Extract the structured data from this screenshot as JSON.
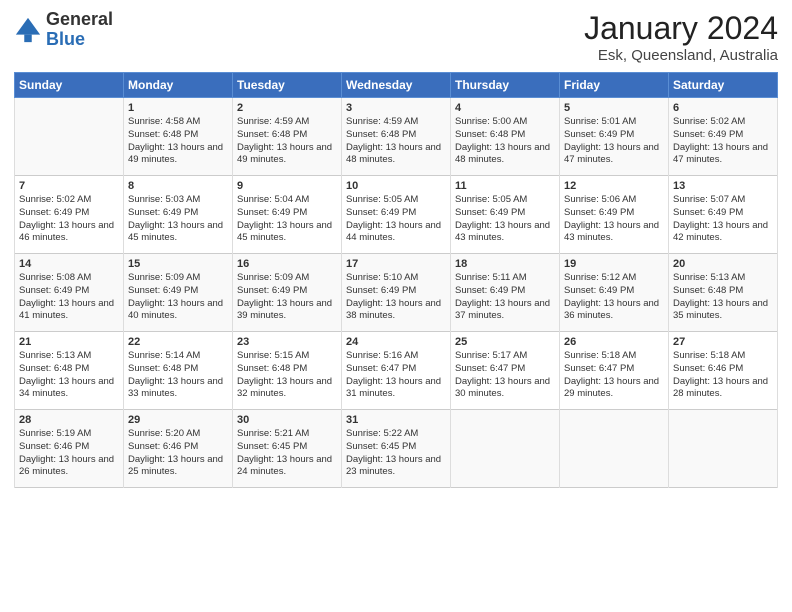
{
  "header": {
    "logo_general": "General",
    "logo_blue": "Blue",
    "month_title": "January 2024",
    "location": "Esk, Queensland, Australia"
  },
  "columns": [
    "Sunday",
    "Monday",
    "Tuesday",
    "Wednesday",
    "Thursday",
    "Friday",
    "Saturday"
  ],
  "weeks": [
    [
      {
        "num": "",
        "sunrise": "",
        "sunset": "",
        "daylight": ""
      },
      {
        "num": "1",
        "sunrise": "Sunrise: 4:58 AM",
        "sunset": "Sunset: 6:48 PM",
        "daylight": "Daylight: 13 hours and 49 minutes."
      },
      {
        "num": "2",
        "sunrise": "Sunrise: 4:59 AM",
        "sunset": "Sunset: 6:48 PM",
        "daylight": "Daylight: 13 hours and 49 minutes."
      },
      {
        "num": "3",
        "sunrise": "Sunrise: 4:59 AM",
        "sunset": "Sunset: 6:48 PM",
        "daylight": "Daylight: 13 hours and 48 minutes."
      },
      {
        "num": "4",
        "sunrise": "Sunrise: 5:00 AM",
        "sunset": "Sunset: 6:48 PM",
        "daylight": "Daylight: 13 hours and 48 minutes."
      },
      {
        "num": "5",
        "sunrise": "Sunrise: 5:01 AM",
        "sunset": "Sunset: 6:49 PM",
        "daylight": "Daylight: 13 hours and 47 minutes."
      },
      {
        "num": "6",
        "sunrise": "Sunrise: 5:02 AM",
        "sunset": "Sunset: 6:49 PM",
        "daylight": "Daylight: 13 hours and 47 minutes."
      }
    ],
    [
      {
        "num": "7",
        "sunrise": "Sunrise: 5:02 AM",
        "sunset": "Sunset: 6:49 PM",
        "daylight": "Daylight: 13 hours and 46 minutes."
      },
      {
        "num": "8",
        "sunrise": "Sunrise: 5:03 AM",
        "sunset": "Sunset: 6:49 PM",
        "daylight": "Daylight: 13 hours and 45 minutes."
      },
      {
        "num": "9",
        "sunrise": "Sunrise: 5:04 AM",
        "sunset": "Sunset: 6:49 PM",
        "daylight": "Daylight: 13 hours and 45 minutes."
      },
      {
        "num": "10",
        "sunrise": "Sunrise: 5:05 AM",
        "sunset": "Sunset: 6:49 PM",
        "daylight": "Daylight: 13 hours and 44 minutes."
      },
      {
        "num": "11",
        "sunrise": "Sunrise: 5:05 AM",
        "sunset": "Sunset: 6:49 PM",
        "daylight": "Daylight: 13 hours and 43 minutes."
      },
      {
        "num": "12",
        "sunrise": "Sunrise: 5:06 AM",
        "sunset": "Sunset: 6:49 PM",
        "daylight": "Daylight: 13 hours and 43 minutes."
      },
      {
        "num": "13",
        "sunrise": "Sunrise: 5:07 AM",
        "sunset": "Sunset: 6:49 PM",
        "daylight": "Daylight: 13 hours and 42 minutes."
      }
    ],
    [
      {
        "num": "14",
        "sunrise": "Sunrise: 5:08 AM",
        "sunset": "Sunset: 6:49 PM",
        "daylight": "Daylight: 13 hours and 41 minutes."
      },
      {
        "num": "15",
        "sunrise": "Sunrise: 5:09 AM",
        "sunset": "Sunset: 6:49 PM",
        "daylight": "Daylight: 13 hours and 40 minutes."
      },
      {
        "num": "16",
        "sunrise": "Sunrise: 5:09 AM",
        "sunset": "Sunset: 6:49 PM",
        "daylight": "Daylight: 13 hours and 39 minutes."
      },
      {
        "num": "17",
        "sunrise": "Sunrise: 5:10 AM",
        "sunset": "Sunset: 6:49 PM",
        "daylight": "Daylight: 13 hours and 38 minutes."
      },
      {
        "num": "18",
        "sunrise": "Sunrise: 5:11 AM",
        "sunset": "Sunset: 6:49 PM",
        "daylight": "Daylight: 13 hours and 37 minutes."
      },
      {
        "num": "19",
        "sunrise": "Sunrise: 5:12 AM",
        "sunset": "Sunset: 6:49 PM",
        "daylight": "Daylight: 13 hours and 36 minutes."
      },
      {
        "num": "20",
        "sunrise": "Sunrise: 5:13 AM",
        "sunset": "Sunset: 6:48 PM",
        "daylight": "Daylight: 13 hours and 35 minutes."
      }
    ],
    [
      {
        "num": "21",
        "sunrise": "Sunrise: 5:13 AM",
        "sunset": "Sunset: 6:48 PM",
        "daylight": "Daylight: 13 hours and 34 minutes."
      },
      {
        "num": "22",
        "sunrise": "Sunrise: 5:14 AM",
        "sunset": "Sunset: 6:48 PM",
        "daylight": "Daylight: 13 hours and 33 minutes."
      },
      {
        "num": "23",
        "sunrise": "Sunrise: 5:15 AM",
        "sunset": "Sunset: 6:48 PM",
        "daylight": "Daylight: 13 hours and 32 minutes."
      },
      {
        "num": "24",
        "sunrise": "Sunrise: 5:16 AM",
        "sunset": "Sunset: 6:47 PM",
        "daylight": "Daylight: 13 hours and 31 minutes."
      },
      {
        "num": "25",
        "sunrise": "Sunrise: 5:17 AM",
        "sunset": "Sunset: 6:47 PM",
        "daylight": "Daylight: 13 hours and 30 minutes."
      },
      {
        "num": "26",
        "sunrise": "Sunrise: 5:18 AM",
        "sunset": "Sunset: 6:47 PM",
        "daylight": "Daylight: 13 hours and 29 minutes."
      },
      {
        "num": "27",
        "sunrise": "Sunrise: 5:18 AM",
        "sunset": "Sunset: 6:46 PM",
        "daylight": "Daylight: 13 hours and 28 minutes."
      }
    ],
    [
      {
        "num": "28",
        "sunrise": "Sunrise: 5:19 AM",
        "sunset": "Sunset: 6:46 PM",
        "daylight": "Daylight: 13 hours and 26 minutes."
      },
      {
        "num": "29",
        "sunrise": "Sunrise: 5:20 AM",
        "sunset": "Sunset: 6:46 PM",
        "daylight": "Daylight: 13 hours and 25 minutes."
      },
      {
        "num": "30",
        "sunrise": "Sunrise: 5:21 AM",
        "sunset": "Sunset: 6:45 PM",
        "daylight": "Daylight: 13 hours and 24 minutes."
      },
      {
        "num": "31",
        "sunrise": "Sunrise: 5:22 AM",
        "sunset": "Sunset: 6:45 PM",
        "daylight": "Daylight: 13 hours and 23 minutes."
      },
      {
        "num": "",
        "sunrise": "",
        "sunset": "",
        "daylight": ""
      },
      {
        "num": "",
        "sunrise": "",
        "sunset": "",
        "daylight": ""
      },
      {
        "num": "",
        "sunrise": "",
        "sunset": "",
        "daylight": ""
      }
    ]
  ]
}
